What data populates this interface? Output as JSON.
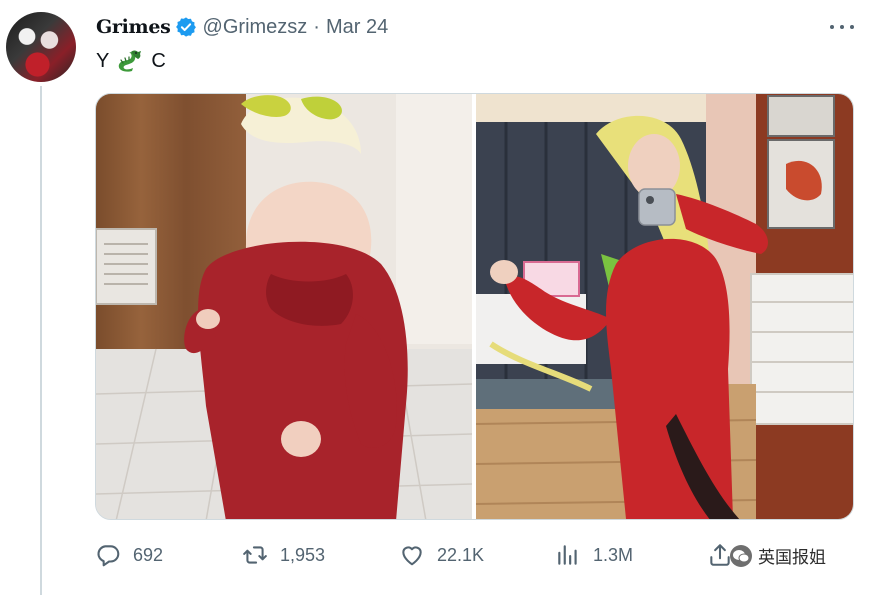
{
  "tweet": {
    "display_name": "Grimes",
    "handle": "@Grimezsz",
    "separator": "·",
    "date": "Mar 24",
    "text_start": "Y",
    "text_end": "C",
    "emoji": "dragon-emoji",
    "media": [
      {
        "name": "photo-toddler-red-outfit"
      },
      {
        "name": "photo-woman-mirror-selfie-red-jumpsuit"
      }
    ]
  },
  "actions": {
    "replies": "692",
    "retweets": "1,953",
    "likes": "22.1K",
    "views": "1.3M"
  },
  "watermark": {
    "text": "英国报姐"
  },
  "icons": {
    "verified": "verified-badge-icon",
    "more": "more-options-icon",
    "reply": "reply-icon",
    "retweet": "retweet-icon",
    "like": "heart-icon",
    "views": "views-chart-icon",
    "share": "share-icon"
  },
  "colors": {
    "text": "#0f1419",
    "secondary": "#536471",
    "verified": "#1d9bf0",
    "border": "#cfd9de",
    "outfit_red": "#b01e24"
  }
}
